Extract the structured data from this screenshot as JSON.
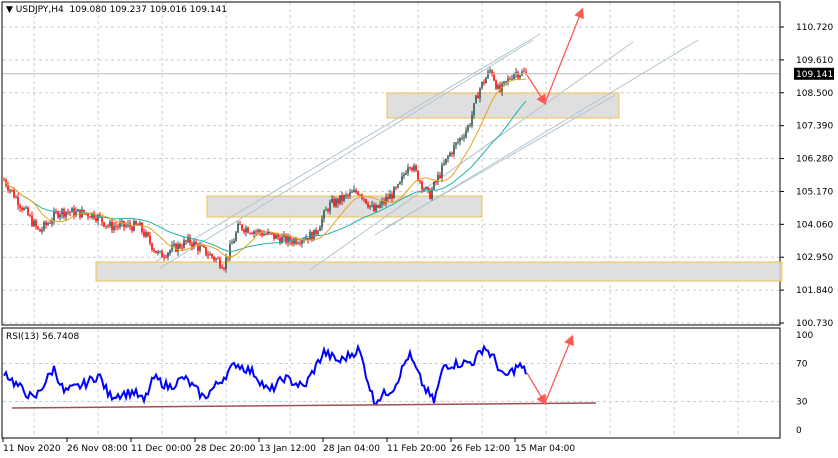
{
  "header": {
    "symbol": "USDJPY,H4",
    "open": "109.080",
    "high": "109.237",
    "low": "109.016",
    "close": "109.141",
    "menu_icon": "triangle-down-icon"
  },
  "price_axis": {
    "ticks": [
      "110.720",
      "109.610",
      "108.500",
      "107.390",
      "106.280",
      "105.170",
      "104.060",
      "102.950",
      "101.840",
      "100.730"
    ],
    "current": "109.141"
  },
  "rsi": {
    "label": "RSI(13)",
    "value": "56.7408",
    "ticks": [
      "100",
      "70",
      "30",
      "0"
    ]
  },
  "time_axis": [
    "11 Nov 2020",
    "26 Nov 08:00",
    "11 Dec 00:00",
    "28 Dec 20:00",
    "13 Jan 12:00",
    "28 Jan 04:00",
    "11 Feb 20:00",
    "26 Feb 12:00",
    "15 Mar 04:00"
  ],
  "colors": {
    "bull": "#2f4f4f",
    "bear": "#ff0000",
    "ma_fast": "#e8a317",
    "ma_slow": "#20b2aa",
    "rsi": "#0000ff",
    "arrow": "#ff5a50",
    "zone": "#d9d9d9",
    "zone_border": "#f2c14e",
    "channel": "#b0c4d0"
  },
  "chart_data": {
    "type": "candlestick",
    "price_range": [
      100.73,
      110.72
    ],
    "price_path": [
      [
        0,
        105.56
      ],
      [
        35,
        103.8
      ],
      [
        55,
        104.5
      ],
      [
        90,
        104.4
      ],
      [
        105,
        104.0
      ],
      [
        135,
        104.0
      ],
      [
        155,
        103.0
      ],
      [
        185,
        103.5
      ],
      [
        220,
        102.7
      ],
      [
        235,
        104.0
      ],
      [
        285,
        103.5
      ],
      [
        310,
        103.7
      ],
      [
        325,
        104.7
      ],
      [
        355,
        105.2
      ],
      [
        370,
        104.5
      ],
      [
        395,
        105.3
      ],
      [
        405,
        106.2
      ],
      [
        425,
        105.0
      ],
      [
        445,
        106.4
      ],
      [
        465,
        107.4
      ],
      [
        475,
        108.6
      ],
      [
        487,
        109.3
      ],
      [
        495,
        108.5
      ],
      [
        510,
        109.2
      ],
      [
        523,
        109.14
      ]
    ],
    "rsi_path": [
      [
        0,
        62
      ],
      [
        10,
        50
      ],
      [
        30,
        32
      ],
      [
        50,
        65
      ],
      [
        60,
        40
      ],
      [
        80,
        48
      ],
      [
        95,
        58
      ],
      [
        105,
        36
      ],
      [
        130,
        40
      ],
      [
        140,
        30
      ],
      [
        150,
        55
      ],
      [
        165,
        45
      ],
      [
        180,
        55
      ],
      [
        200,
        34
      ],
      [
        215,
        50
      ],
      [
        232,
        70
      ],
      [
        250,
        60
      ],
      [
        265,
        40
      ],
      [
        280,
        55
      ],
      [
        300,
        45
      ],
      [
        320,
        82
      ],
      [
        335,
        72
      ],
      [
        355,
        85
      ],
      [
        370,
        30
      ],
      [
        390,
        45
      ],
      [
        405,
        80
      ],
      [
        420,
        45
      ],
      [
        430,
        30
      ],
      [
        440,
        68
      ],
      [
        470,
        72
      ],
      [
        480,
        88
      ],
      [
        490,
        75
      ],
      [
        500,
        55
      ],
      [
        515,
        68
      ],
      [
        523,
        60
      ]
    ],
    "rsi_range": [
      0,
      100
    ]
  }
}
